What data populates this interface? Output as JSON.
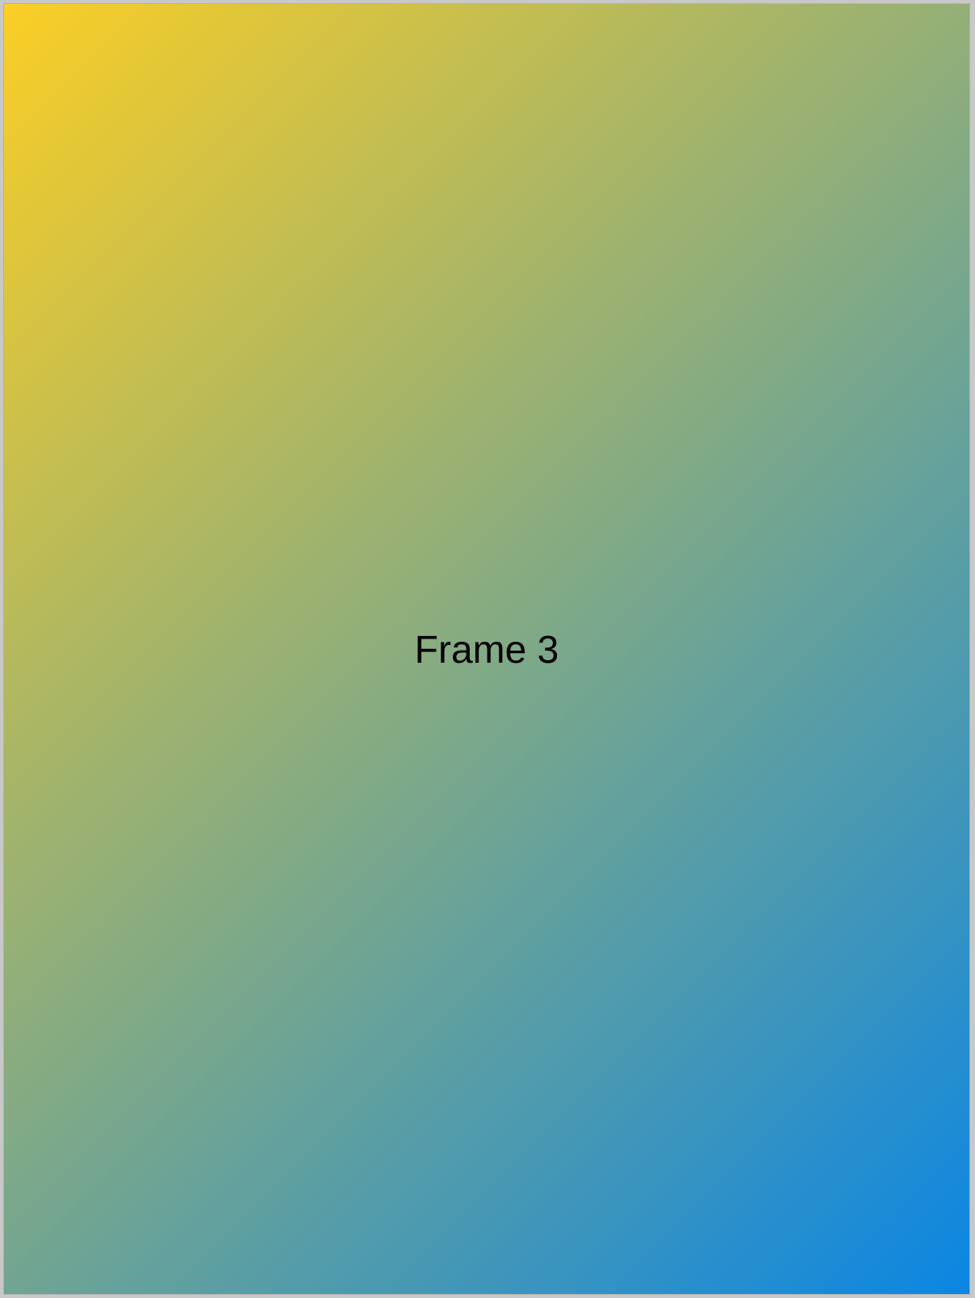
{
  "frame": {
    "label": "Frame 3",
    "gradient_start_color": "#fbce25",
    "gradient_end_color": "#0a86e4"
  }
}
